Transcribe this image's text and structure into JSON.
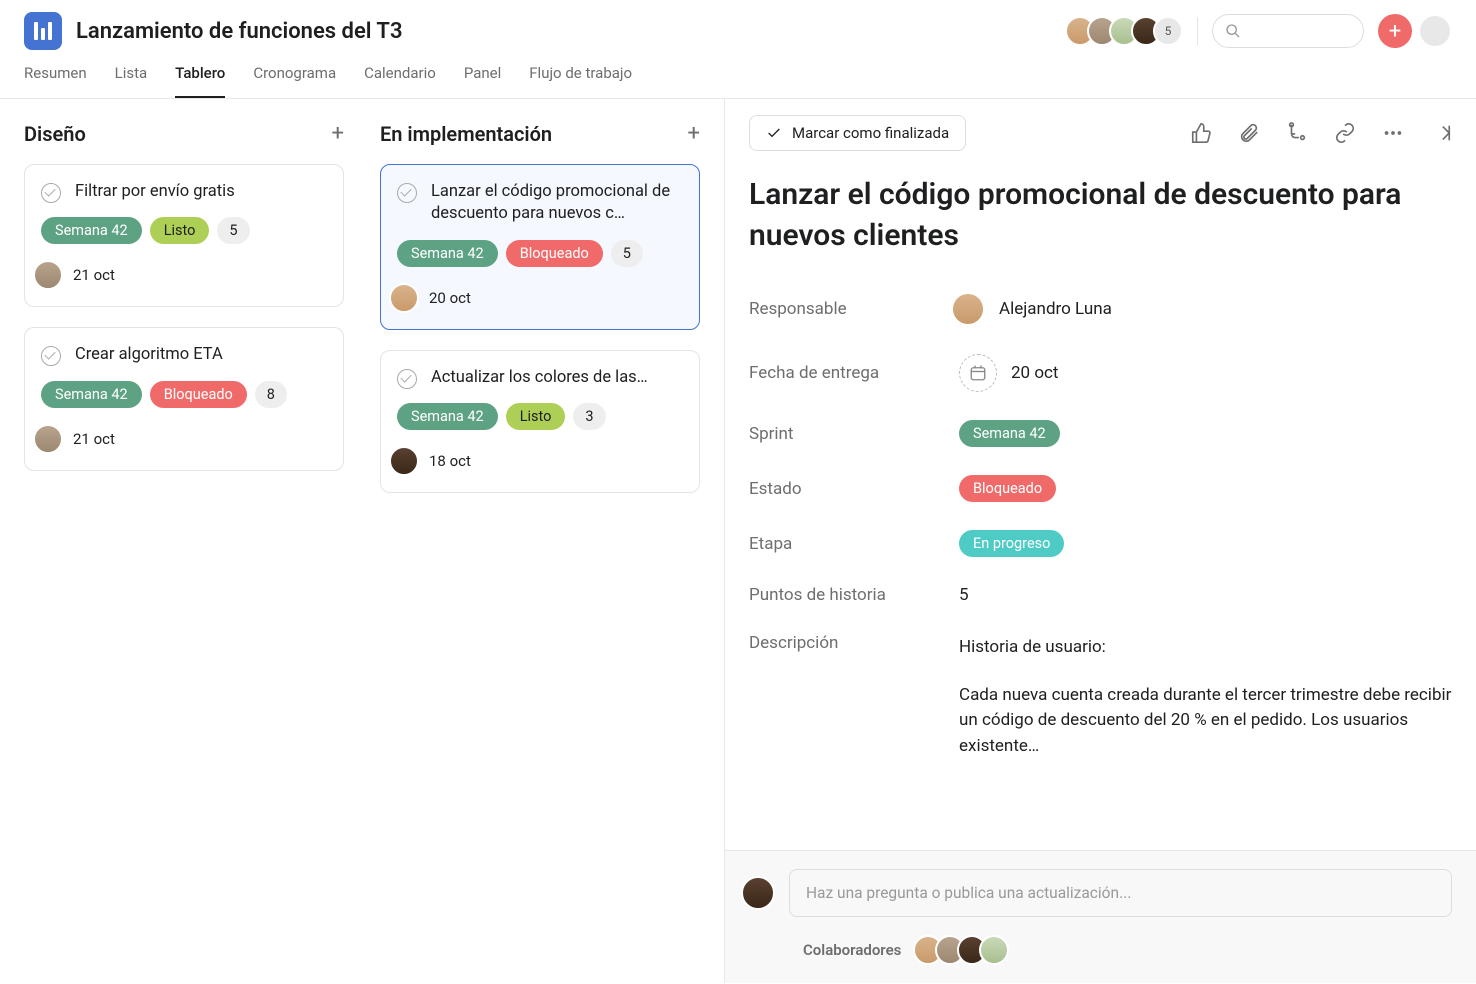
{
  "project_title": "Lanzamiento de funciones del T3",
  "overflow_count": "5",
  "tabs": [
    "Resumen",
    "Lista",
    "Tablero",
    "Cronograma",
    "Calendario",
    "Panel",
    "Flujo de trabajo"
  ],
  "active_tab": "Tablero",
  "columns": [
    {
      "title": "Diseño",
      "cards": [
        {
          "title": "Filtrar por envío gratis",
          "sprint": "Semana 42",
          "status": "Listo",
          "status_type": "lime",
          "points": "5",
          "date": "21 oct",
          "avatar": "a2"
        },
        {
          "title": "Crear algoritmo ETA",
          "sprint": "Semana 42",
          "status": "Bloqueado",
          "status_type": "red",
          "points": "8",
          "date": "21 oct",
          "avatar": "a2"
        }
      ]
    },
    {
      "title": "En implementación",
      "cards": [
        {
          "title": "Lanzar el código promocional de descuento para nuevos c…",
          "sprint": "Semana 42",
          "status": "Bloqueado",
          "status_type": "red",
          "points": "5",
          "date": "20 oct",
          "avatar": "a1",
          "selected": true
        },
        {
          "title": "Actualizar los colores de las…",
          "sprint": "Semana 42",
          "status": "Listo",
          "status_type": "lime",
          "points": "3",
          "date": "18 oct",
          "avatar": "a4"
        }
      ]
    }
  ],
  "detail": {
    "complete_label": "Marcar como finalizada",
    "title": "Lanzar el código promocional de descuento para nuevos clientes",
    "fields": {
      "responsable_label": "Responsable",
      "responsable_value": "Alejandro Luna",
      "fecha_label": "Fecha de entrega",
      "fecha_value": "20 oct",
      "sprint_label": "Sprint",
      "sprint_value": "Semana 42",
      "estado_label": "Estado",
      "estado_value": "Bloqueado",
      "etapa_label": "Etapa",
      "etapa_value": "En progreso",
      "puntos_label": "Puntos de historia",
      "puntos_value": "5",
      "desc_label": "Descripción",
      "desc_heading": "Historia de usuario:",
      "desc_body": "Cada nueva cuenta creada durante el tercer trimestre debe recibir un código de descuento del 20 % en el pedido. Los usuarios existente…"
    },
    "comment_placeholder": "Haz una pregunta o publica una actualización...",
    "collaborators_label": "Colaboradores"
  }
}
